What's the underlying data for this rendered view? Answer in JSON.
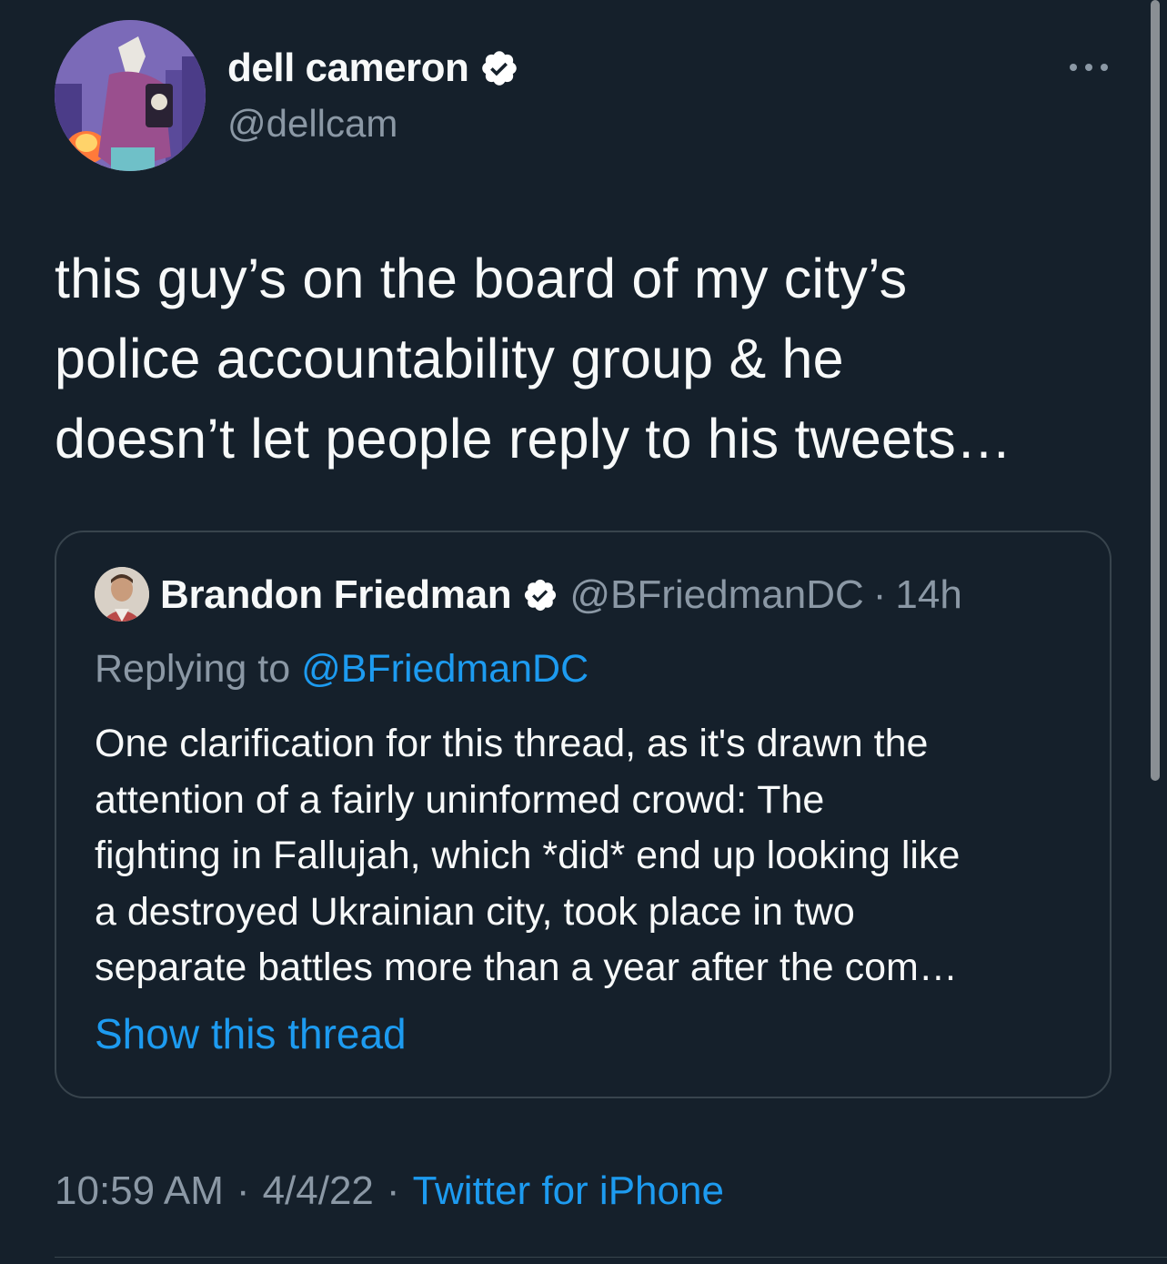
{
  "author": {
    "display_name": "dell cameron",
    "handle": "@dellcam",
    "verified": true
  },
  "tweet": {
    "text_lines": [
      "this guy’s on the board of my city’s",
      "police accountability group & he",
      "doesn’t let people reply to his tweets…"
    ]
  },
  "quoted_tweet": {
    "display_name": "Brandon Friedman",
    "handle": "@BFriedmanDC",
    "separator": "·",
    "time_ago": "14h",
    "replying_prefix": "Replying to ",
    "replying_to": "@BFriedmanDC",
    "text_lines": [
      "One clarification for this thread, as it's drawn the",
      "attention of a fairly uninformed crowd: The",
      "fighting in Fallujah, which *did* end up looking like",
      "a destroyed Ukrainian city, took place in two",
      "separate battles more than a year after the com…"
    ],
    "show_thread_label": "Show this thread"
  },
  "meta": {
    "time": "10:59 AM",
    "date": "4/4/22",
    "separator": "·",
    "source": "Twitter for iPhone"
  },
  "icons": {
    "verified": "verified-badge-icon",
    "more": "more-horizontal-icon"
  },
  "colors": {
    "background": "#15202b",
    "text": "#f7f9f9",
    "secondary": "#8b98a5",
    "accent": "#1d9bf0",
    "border": "#38444d"
  }
}
